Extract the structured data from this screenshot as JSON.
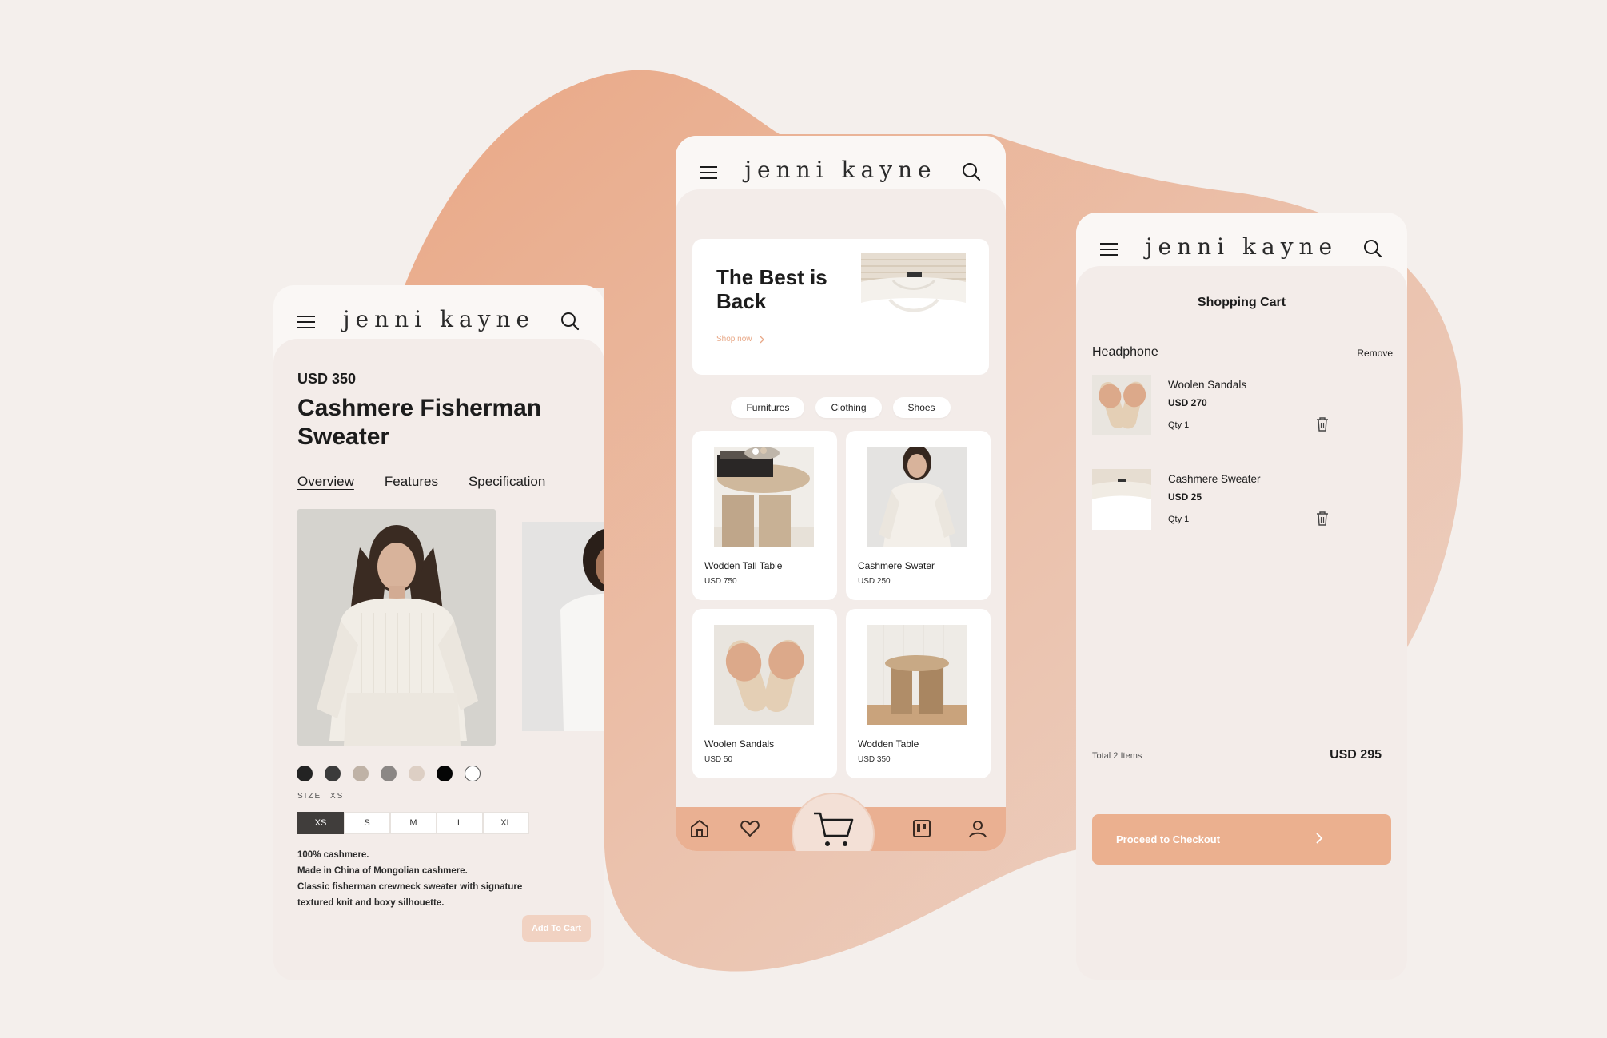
{
  "brand": "jenni kayne",
  "colors": {
    "background": "#f4efec",
    "accent": "#ebb08f",
    "blob": "#ebb49a"
  },
  "product": {
    "price": "USD 350",
    "title": "Cashmere Fisherman Sweater",
    "tabs": [
      "Overview",
      "Features",
      "Specification"
    ],
    "active_tab": "Overview",
    "swatches": [
      "#232323",
      "#3b3b3b",
      "#bfb2a6",
      "#8b8785",
      "#ddcfc4",
      "#050505",
      "#ffffff"
    ],
    "size_label": "SIZE",
    "selected_size": "XS",
    "sizes": [
      "XS",
      "S",
      "M",
      "L",
      "XL"
    ],
    "description": [
      "100% cashmere.",
      "Made in China of Mongolian cashmere.",
      "Classic fisherman crewneck sweater with signature",
      "textured knit and boxy silhouette."
    ],
    "add_to_cart": "Add To Cart"
  },
  "home": {
    "hero_title": "The Best is Back",
    "hero_link": "Shop now",
    "categories": [
      "Furnitures",
      "Clothing",
      "Shoes"
    ],
    "products": [
      {
        "name": "Wodden Tall Table",
        "price": "USD 750",
        "icon": "tall-table"
      },
      {
        "name": "Cashmere Swater",
        "price": "USD 250",
        "icon": "sweater-model"
      },
      {
        "name": "Woolen Sandals",
        "price": "USD 50",
        "icon": "sandals"
      },
      {
        "name": "Wodden Table",
        "price": "USD 350",
        "icon": "wooden-stool"
      }
    ],
    "nav_icons": [
      "home-icon",
      "heart-icon",
      "cart-icon",
      "board-icon",
      "user-icon"
    ]
  },
  "cart": {
    "title": "Shopping Cart",
    "section": "Headphone",
    "remove": "Remove",
    "items": [
      {
        "name": "Woolen Sandals",
        "price": "USD 270",
        "qty": "Qty 1"
      },
      {
        "name": "Cashmere Sweater",
        "price": "USD 25",
        "qty": "Qty 1"
      }
    ],
    "total_label": "Total 2 Items",
    "total_value": "USD 295",
    "checkout": "Proceed to Checkout"
  }
}
